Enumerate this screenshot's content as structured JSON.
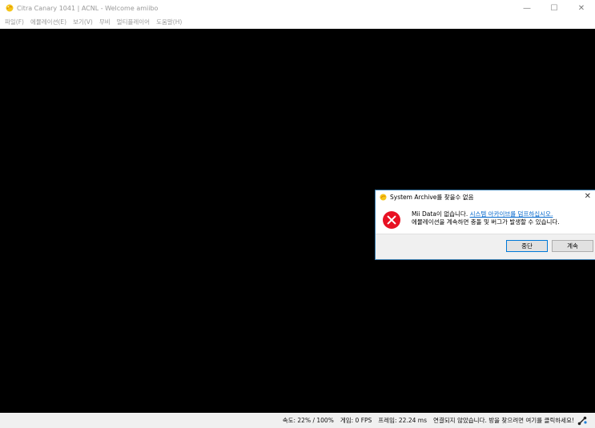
{
  "window": {
    "title": "Citra Canary 1041 | ACNL - Welcome amiibo",
    "controls": {
      "minimize": "—",
      "maximize": "☐",
      "close": "✕"
    }
  },
  "menu": {
    "items": [
      {
        "label": "파일(F)"
      },
      {
        "label": "에뮬레이션(E)"
      },
      {
        "label": "보기(V)"
      },
      {
        "label": "무비"
      },
      {
        "label": "멀티플레이어"
      },
      {
        "label": "도움말(H)"
      }
    ]
  },
  "dialog": {
    "title": "System Archive를 찾을수 없음",
    "close": "✕",
    "message_line1_prefix": "Mii Data이 없습니다. ",
    "message_link": "시스템 아카이브를 덤프하십시오.",
    "message_line2": "에뮬레이션을 계속하면 충돌 및 버그가 발생할 수 있습니다.",
    "buttons": {
      "abort": "중단",
      "continue": "계속"
    },
    "icon": "error-icon"
  },
  "status": {
    "speed": "속도: 22% / 100%",
    "game": "게임: 0 FPS",
    "frame": "프레임: 22.24 ms",
    "network": "연결되지 않았습니다.  방을 찾으려면 여기를 클릭하세요!",
    "icon": "network-icon"
  },
  "colors": {
    "render_bg": "#000000",
    "dialog_border": "#3c7fb1",
    "error": "#e81123",
    "link": "#0066cc"
  }
}
